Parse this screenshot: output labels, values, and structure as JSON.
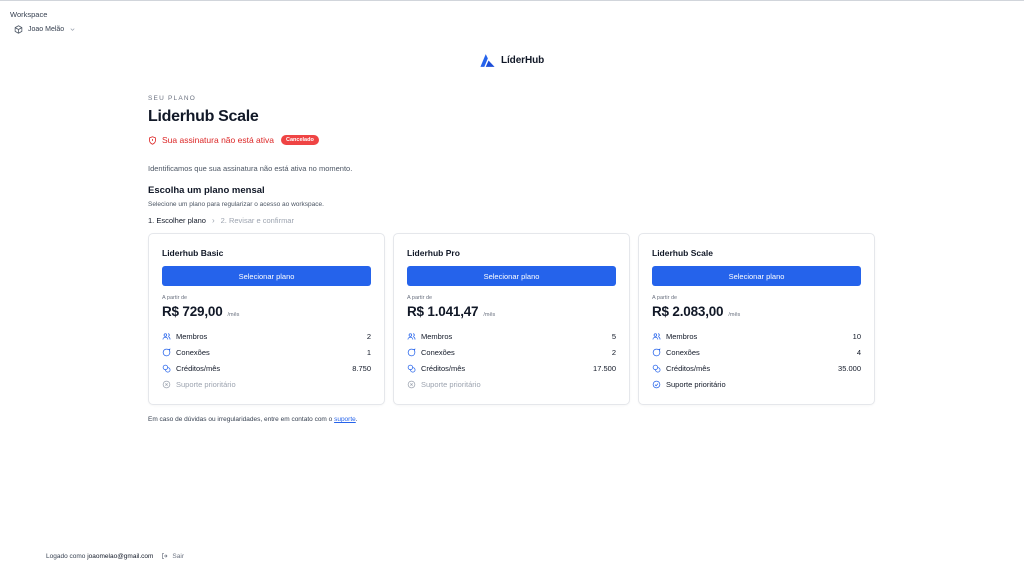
{
  "workspace": {
    "label": "Workspace",
    "current": "Joao Melão"
  },
  "logo": {
    "text": "LíderHub"
  },
  "plan": {
    "eyebrow": "SEU PLANO",
    "title": "Liderhub Scale",
    "status_text": "Sua assinatura não está ativa",
    "status_badge": "Cancelado"
  },
  "info_text": "Identificamos que sua assinatura não está ativa no momento.",
  "choose": {
    "title": "Escolha um plano mensal",
    "subtitle": "Selecione um plano para regularizar o acesso ao workspace."
  },
  "steps": {
    "step1": "1. Escolher plano",
    "separator": "›",
    "step2": "2. Revisar e confirmar"
  },
  "cards": [
    {
      "name": "Liderhub Basic",
      "button": "Selecionar plano",
      "from_label": "A partir de",
      "price": "R$ 729,00",
      "unit": "/mês",
      "features": {
        "members_label": "Membros",
        "members_value": "2",
        "connections_label": "Conexões",
        "connections_value": "1",
        "credits_label": "Créditos/mês",
        "credits_value": "8.750",
        "support_label": "Suporte prioritário"
      }
    },
    {
      "name": "Liderhub Pro",
      "button": "Selecionar plano",
      "from_label": "A partir de",
      "price": "R$ 1.041,47",
      "unit": "/mês",
      "features": {
        "members_label": "Membros",
        "members_value": "5",
        "connections_label": "Conexões",
        "connections_value": "2",
        "credits_label": "Créditos/mês",
        "credits_value": "17.500",
        "support_label": "Suporte prioritário"
      }
    },
    {
      "name": "Liderhub Scale",
      "button": "Selecionar plano",
      "from_label": "A partir de",
      "price": "R$ 2.083,00",
      "unit": "/mês",
      "features": {
        "members_label": "Membros",
        "members_value": "10",
        "connections_label": "Conexões",
        "connections_value": "4",
        "credits_label": "Créditos/mês",
        "credits_value": "35.000",
        "support_label": "Suporte prioritário"
      }
    }
  ],
  "footer_note": {
    "text": "Em caso de dúvidas ou irregularidades, entre em contato com o ",
    "link": "suporte",
    "end": "."
  },
  "bottom": {
    "logged_as": "Logado como",
    "email": "joaomelao@gmail.com",
    "logout": "Sair"
  },
  "colors": {
    "primary": "#2563eb",
    "danger": "#dc2626",
    "badge": "#ef4444",
    "muted": "#9ca3af"
  }
}
